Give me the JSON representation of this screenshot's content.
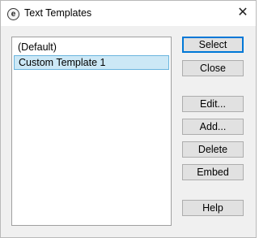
{
  "window": {
    "title": "Text Templates",
    "app_icon_glyph": "e",
    "close_glyph": "✕"
  },
  "templates": {
    "items": [
      {
        "label": "(Default)",
        "selected": false
      },
      {
        "label": "Custom Template 1",
        "selected": true
      }
    ]
  },
  "buttons": {
    "select": "Select",
    "close": "Close",
    "edit": "Edit...",
    "add": "Add...",
    "delete": "Delete",
    "embed": "Embed",
    "help": "Help"
  },
  "colors": {
    "selection_background": "#cce8f6",
    "selection_border": "#6ab5de",
    "default_button_border": "#0078d7"
  }
}
